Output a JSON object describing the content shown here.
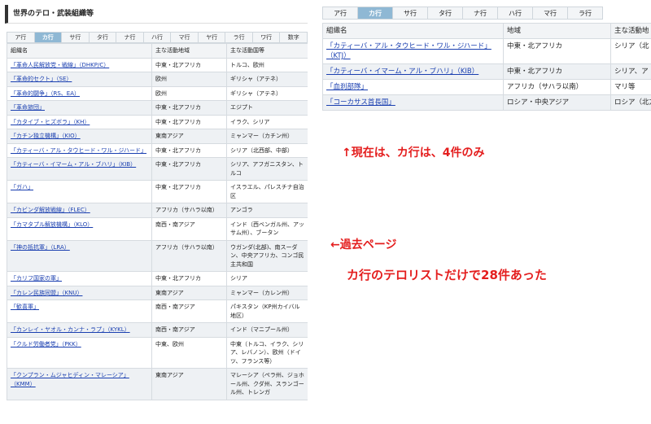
{
  "left": {
    "title": "世界のテロ・武装組織等",
    "tabs": [
      {
        "label": "ア行",
        "active": false
      },
      {
        "label": "カ行",
        "active": true
      },
      {
        "label": "サ行",
        "active": false
      },
      {
        "label": "タ行",
        "active": false
      },
      {
        "label": "ナ行",
        "active": false
      },
      {
        "label": "ハ行",
        "active": false
      },
      {
        "label": "マ行",
        "active": false
      },
      {
        "label": "ヤ行",
        "active": false
      },
      {
        "label": "ラ行",
        "active": false
      },
      {
        "label": "ワ行",
        "active": false
      },
      {
        "label": "数字",
        "active": false
      }
    ],
    "headers": [
      "組織名",
      "主な活動地域",
      "主な活動国等"
    ],
    "rows": [
      [
        "「革命人民解放党・戦線」（DHKP/C）",
        "中東・北アフリカ",
        "トルコ、欧州"
      ],
      [
        "「革命的セクト」（SE）",
        "欧州",
        "ギリシャ（アテネ）"
      ],
      [
        "「革命的闘争」（RS、EA）",
        "欧州",
        "ギリシャ（アテネ）"
      ],
      [
        "「革命旅団」",
        "中東・北アフリカ",
        "エジプト"
      ],
      [
        "「カタイブ・ヒズボラ」（KH）",
        "中東・北アフリカ",
        "イラク、シリア"
      ],
      [
        "「カチン独立機構」（KIO）",
        "東南アジア",
        "ミャンマー（カチン州）"
      ],
      [
        "「カティーバ・アル・タウヒード・ワル・ジハード」",
        "中東・北アフリカ",
        "シリア（北西部、中部）"
      ],
      [
        "「カティーバ・イマーム・アル・ブハリ」（KIB）",
        "中東・北アフリカ",
        "シリア、アフガニスタン、トルコ"
      ],
      [
        "「ガハ」",
        "中東・北アフリカ",
        "イスラエル、パレスチナ自治区"
      ],
      [
        "「カビンダ解放戦線」（FLEC）",
        "アフリカ（サハラ以南）",
        "アンゴラ"
      ],
      [
        "「カマタプル解放機構」（KLO）",
        "南西・南アジア",
        "インド（西ベンガル州、アッサム州）、ブータン"
      ],
      [
        "「神の抵抗軍」（LRA）",
        "アフリカ（サハラ以南）",
        "ウガンダ(北部)、南スーダン、中央アフリカ、コンゴ民主共和国"
      ],
      [
        "「カリフ国家の軍」",
        "中東・北アフリカ",
        "シリア"
      ],
      [
        "「カレン民族同盟」（KNU）",
        "東南アジア",
        "ミャンマー（カレン州）"
      ],
      [
        "「歓喜軍」",
        "南西・南アジア",
        "パキスタン（KP州カイバル地区）"
      ],
      [
        "「カンレイ・ヤオル・カンナ・ラプ」（KYKL）",
        "南西・南アジア",
        "インド（マニプール州）"
      ],
      [
        "「クルド労働者党」（PKK）",
        "中東、欧州",
        "中東（トルコ、イラク、シリア、レバノン）、欧州（ドイツ、フランス等）"
      ],
      [
        "「クンプラン・ムジャヒディン・マレーシア」（KMM）",
        "東南アジア",
        "マレーシア（ペラ州、ジョホール州、クダ州、スランゴール州、トレンガ"
      ]
    ]
  },
  "right": {
    "tabs": [
      {
        "label": "ア行",
        "active": false
      },
      {
        "label": "カ行",
        "active": true
      },
      {
        "label": "サ行",
        "active": false
      },
      {
        "label": "タ行",
        "active": false
      },
      {
        "label": "ナ行",
        "active": false
      },
      {
        "label": "ハ行",
        "active": false
      },
      {
        "label": "マ行",
        "active": false
      },
      {
        "label": "ラ行",
        "active": false
      }
    ],
    "headers": [
      "組織名",
      "地域",
      "主な活動地"
    ],
    "rows": [
      [
        "「カティーバ・アル・タウヒード・ワル・ジハード」（KTJ）",
        "中東・北アフリカ",
        "シリア（北"
      ],
      [
        "「カティーバ・イマーム・アル・ブハリ」（KIB）",
        "中東・北アフリカ",
        "シリア、ア"
      ],
      [
        "「血刹部隊」",
        "アフリカ（サハラ以南）",
        "マリ等"
      ],
      [
        "「コーカサス首長国」",
        "ロシア・中央アジア",
        "ロシア（北方）"
      ]
    ]
  },
  "annotations": {
    "current": "↑現在は、カ行は、4件のみ",
    "past": "←過去ページ",
    "count": "カ行のテロリストだけで28件あった"
  },
  "colors": {
    "annotation": "#e41e1e",
    "active_tab": "#8fb8d4",
    "link": "#1a3fb0"
  }
}
